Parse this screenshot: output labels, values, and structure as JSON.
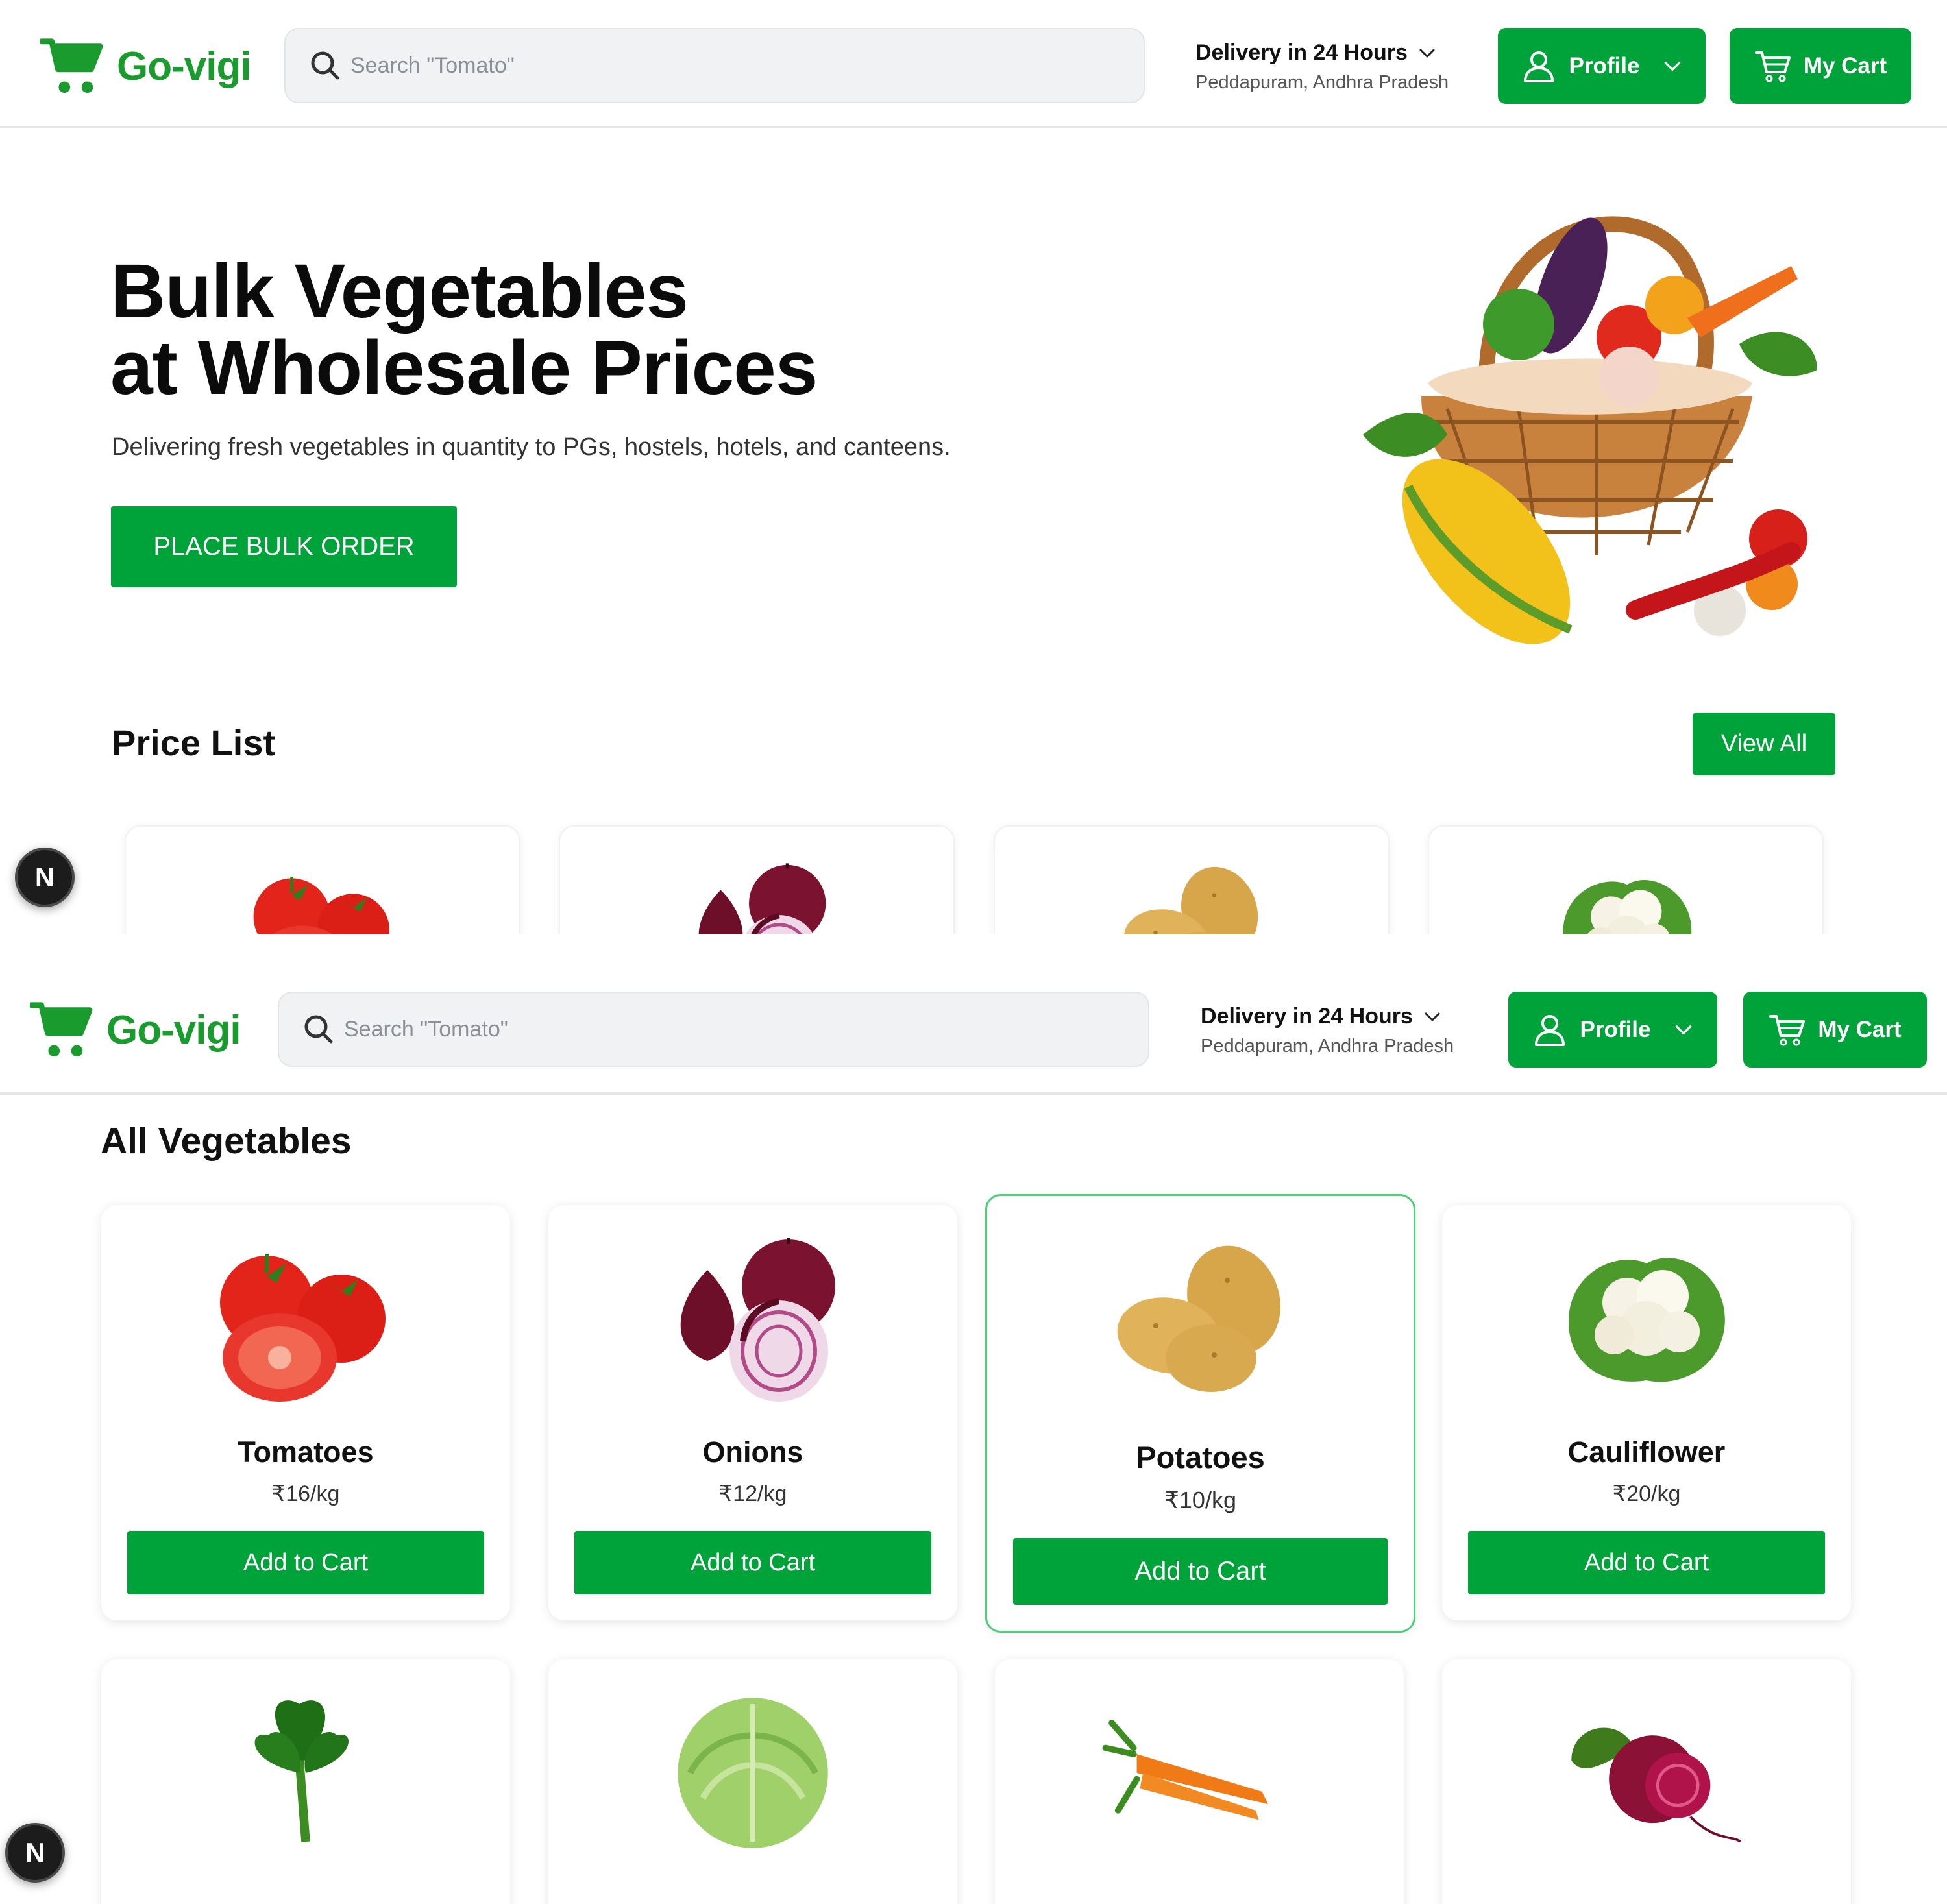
{
  "brand": {
    "name": "Go-vigi",
    "color": "#1a9b2e"
  },
  "accent": "#00a33a",
  "search": {
    "placeholder": "Search \"Tomato\""
  },
  "delivery": {
    "title": "Delivery in 24 Hours",
    "location": "Peddapuram, Andhra Pradesh"
  },
  "profile_label": "Profile",
  "cart_label": "My Cart",
  "hero": {
    "line1": "Bulk Vegetables",
    "line2": "at Wholesale Prices",
    "subtitle": "Delivering fresh vegetables in quantity to PGs, hostels, hotels, and canteens.",
    "button": "PLACE BULK ORDER"
  },
  "price_list": {
    "title": "Price List",
    "view_all": "View All"
  },
  "badge": "N",
  "all_vegetables": {
    "title": "All Vegetables",
    "add_label": "Add to Cart"
  },
  "vegetables": [
    {
      "name": "Tomatoes",
      "price": "₹16/kg"
    },
    {
      "name": "Onions",
      "price": "₹12/kg"
    },
    {
      "name": "Potatoes",
      "price": "₹10/kg"
    },
    {
      "name": "Cauliflower",
      "price": "₹20/kg"
    }
  ],
  "icons": [
    "cart-logo-icon",
    "search-icon",
    "chevron-down-icon",
    "user-icon",
    "cart-icon"
  ]
}
